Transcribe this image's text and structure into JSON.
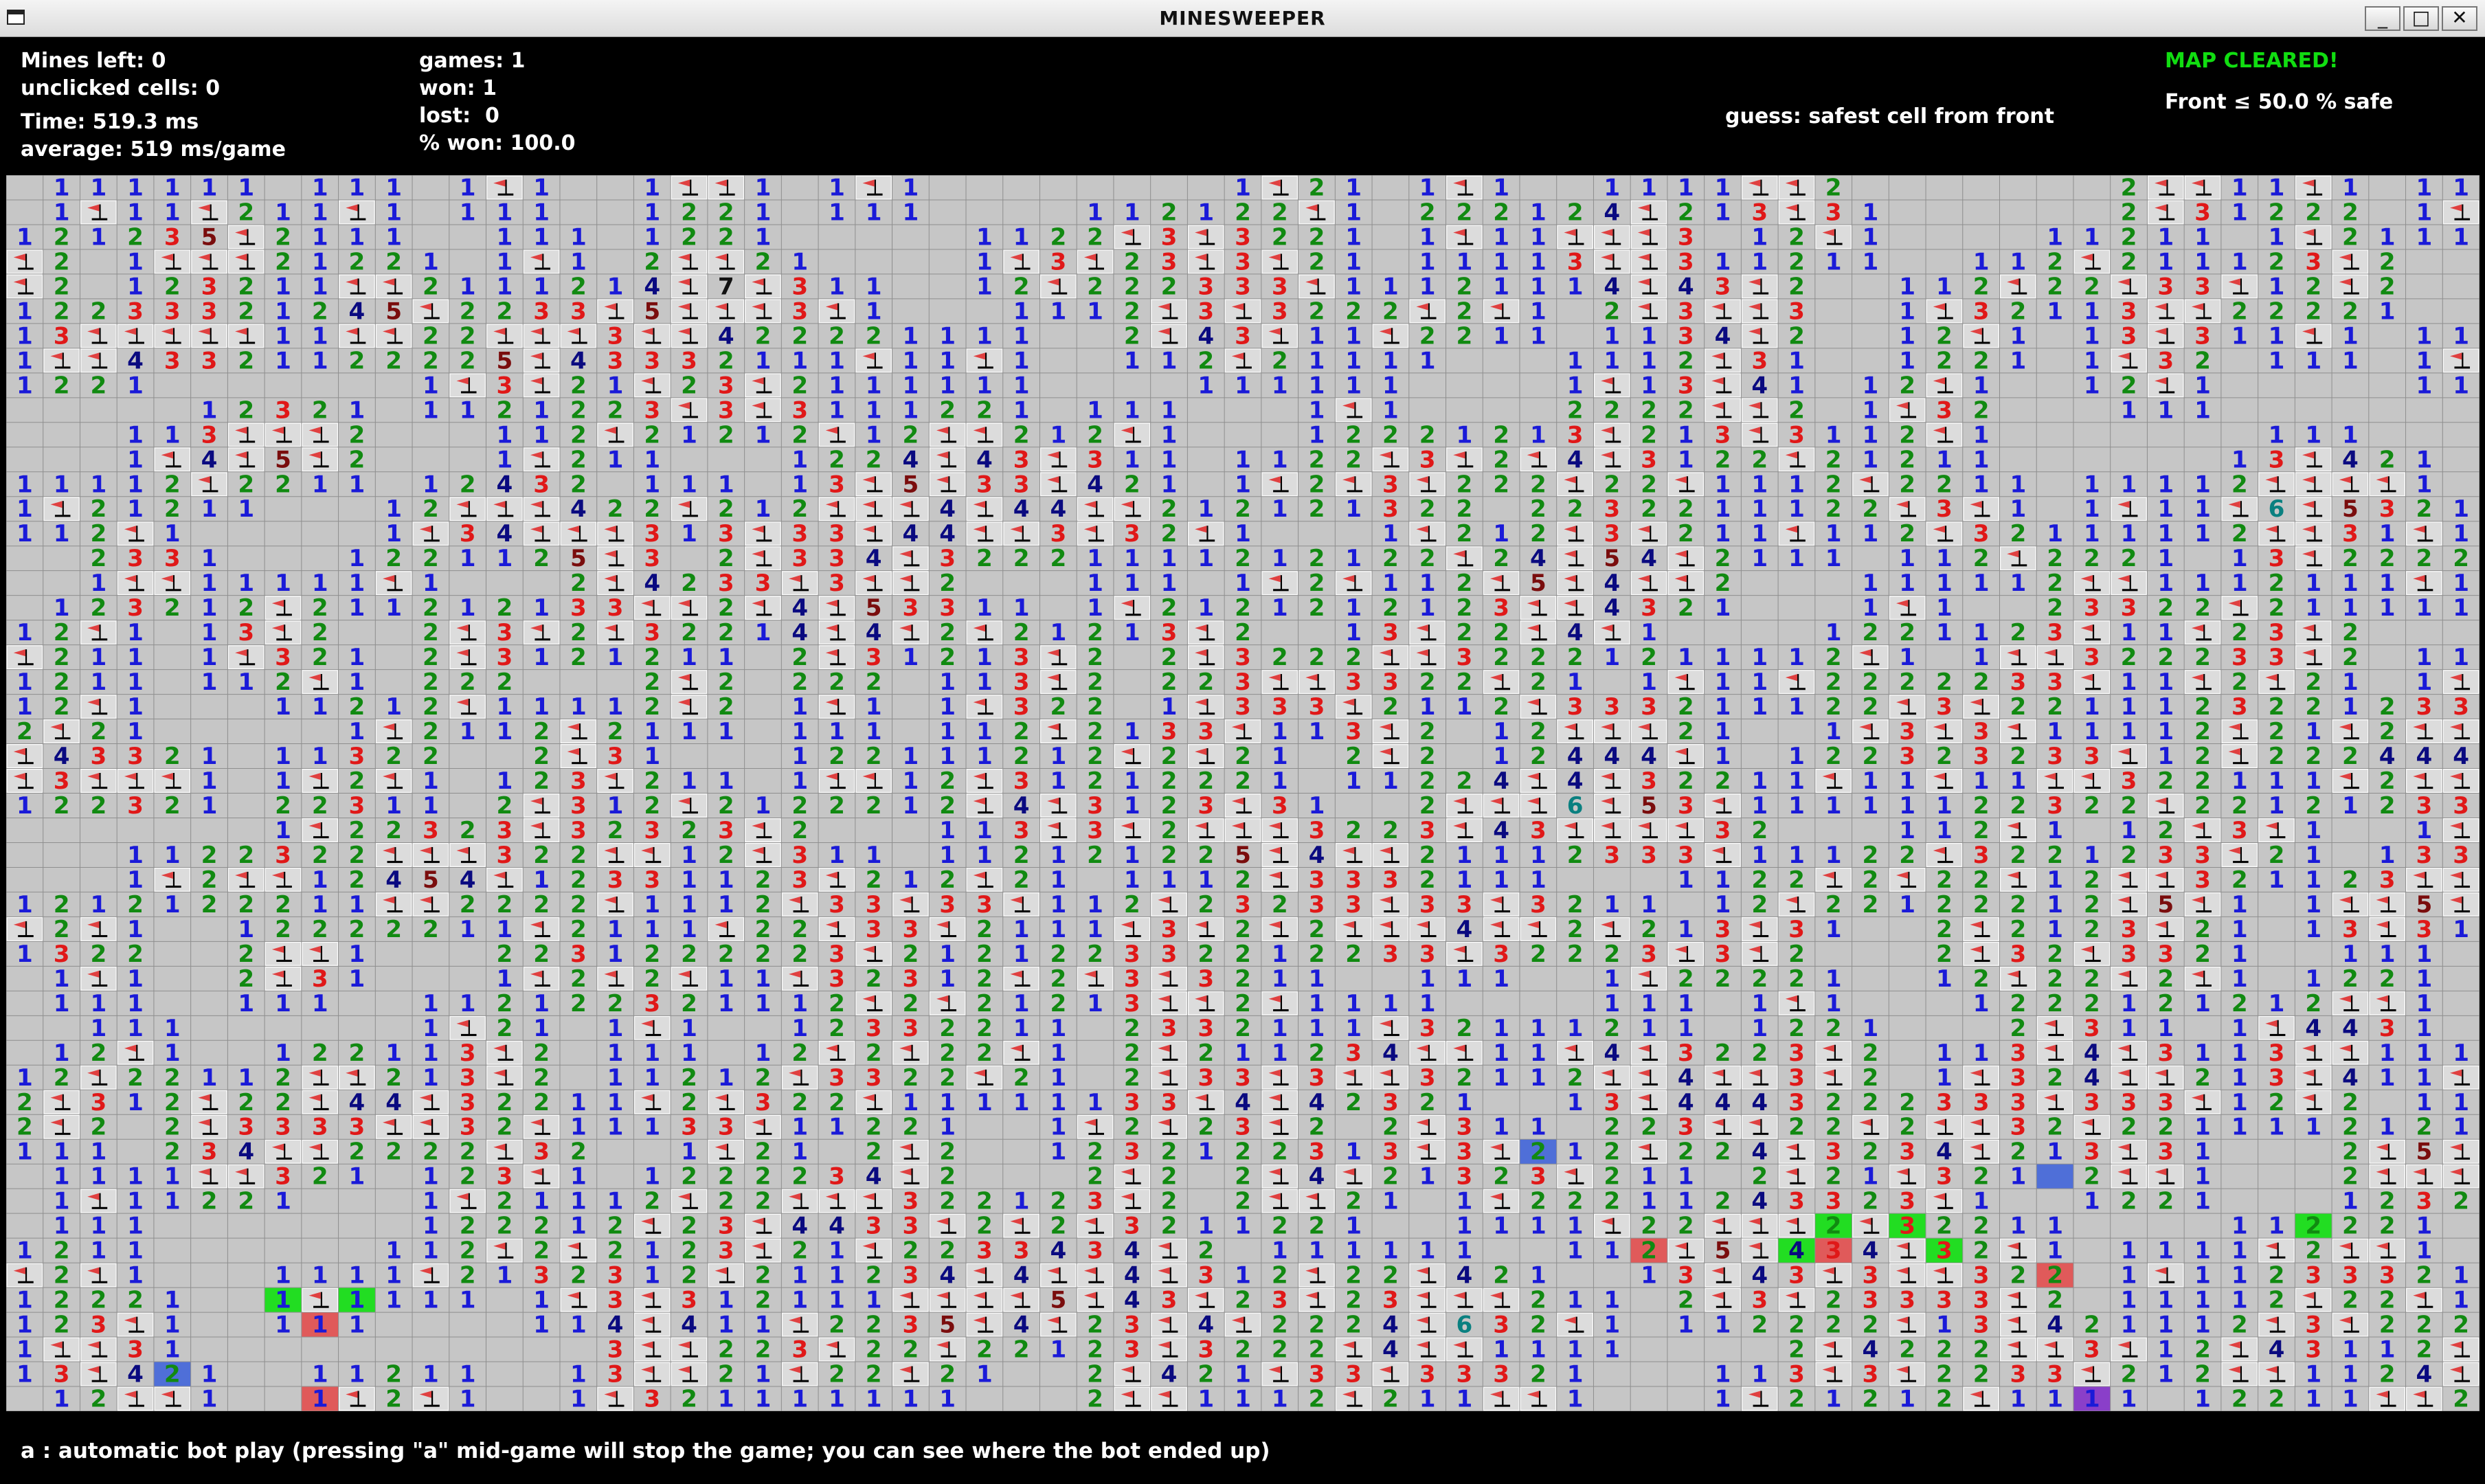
{
  "window": {
    "title": "MINESWEEPER",
    "buttons": {
      "minimize": "_",
      "maximize": "□",
      "close": "✕"
    }
  },
  "stats": {
    "mines_left": "Mines left: 0",
    "unclicked": "unclicked cells: 0",
    "time": "Time: 519.3 ms",
    "average": "average: 519 ms/game"
  },
  "games": {
    "games": "games: 1",
    "won": "won: 1",
    "lost": "lost:  0",
    "pct_won": "% won: 100.0"
  },
  "status": {
    "map_cleared": "MAP CLEARED!",
    "front_safe": "Front ≤ 50.0 % safe",
    "guess": "guess: safest cell from front"
  },
  "board": {
    "columns": 67,
    "rows": 50,
    "state": "fully revealed",
    "cell_colors": {
      "background": "#c6c6c6",
      "grid": "#8e8e8e",
      "one": "#1a1ad8",
      "two": "#118a11",
      "three": "#e01818",
      "four": "#0a0a80",
      "five": "#7a0d0d",
      "six": "#0a8080",
      "seven": "#111111",
      "flag_cell": "#dcdcdc",
      "flag_red": "#e04040",
      "flag_post": "#000000",
      "highlight_green": "#22dd22",
      "highlight_red": "#e05a5a",
      "highlight_blue": "#4f6fd8",
      "highlight_purple": "#8a3fc9"
    }
  },
  "footer": {
    "help_line": "a : automatic bot play (pressing \"a\" mid-game will stop the game; you can see where the bot ended up)"
  }
}
